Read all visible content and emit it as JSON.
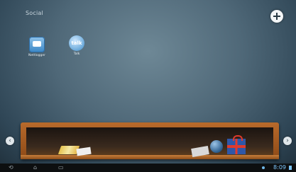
{
  "folder": {
    "name": "Social"
  },
  "apps": [
    {
      "label": "Nettlogger",
      "icon": "twitter-client-icon"
    },
    {
      "label": "Talk",
      "icon": "talk-icon",
      "icon_text": "talk"
    }
  ],
  "top_bar": {
    "add_icon": "plus-icon"
  },
  "shelf": {
    "nav_left": "‹",
    "nav_right": "›"
  },
  "system_bar": {
    "back": "⟲",
    "home": "⌂",
    "recent": "▭",
    "time": "8:09"
  }
}
